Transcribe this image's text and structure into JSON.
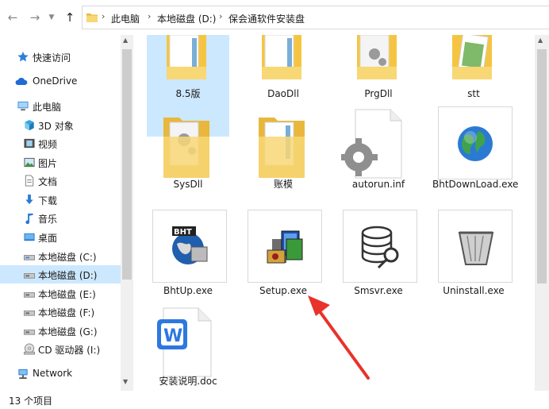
{
  "address": {
    "crumbs": [
      "此电脑",
      "本地磁盘 (D:)",
      "保会通软件安装盘"
    ],
    "back_icon": "arrow-left-icon",
    "forward_icon": "arrow-right-icon",
    "up_icon": "arrow-up-icon"
  },
  "nav": {
    "items": [
      {
        "label": "快速访问",
        "icon": "star-icon"
      },
      {
        "label": "OneDrive",
        "icon": "cloud-icon"
      },
      {
        "label": "此电脑",
        "icon": "computer-icon"
      },
      {
        "label": "3D 对象",
        "icon": "cube-icon"
      },
      {
        "label": "视频",
        "icon": "film-icon"
      },
      {
        "label": "图片",
        "icon": "picture-icon"
      },
      {
        "label": "文档",
        "icon": "document-icon"
      },
      {
        "label": "下载",
        "icon": "download-icon"
      },
      {
        "label": "音乐",
        "icon": "music-icon"
      },
      {
        "label": "桌面",
        "icon": "desktop-icon"
      },
      {
        "label": "本地磁盘 (C:)",
        "icon": "drive-icon"
      },
      {
        "label": "本地磁盘 (D:)",
        "icon": "drive-icon",
        "selected": true
      },
      {
        "label": "本地磁盘 (E:)",
        "icon": "drive-icon"
      },
      {
        "label": "本地磁盘 (F:)",
        "icon": "drive-icon"
      },
      {
        "label": "本地磁盘 (G:)",
        "icon": "drive-icon"
      },
      {
        "label": "CD 驱动器 (I:)",
        "icon": "cd-drive-icon"
      },
      {
        "label": "Network",
        "icon": "network-icon"
      }
    ]
  },
  "files": [
    {
      "name": "8.5版",
      "type": "folder",
      "selected": true
    },
    {
      "name": "DaoDll",
      "type": "folder"
    },
    {
      "name": "PrgDll",
      "type": "folder"
    },
    {
      "name": "stt",
      "type": "folder"
    },
    {
      "name": "SysDll",
      "type": "folder"
    },
    {
      "name": "账模",
      "type": "folder"
    },
    {
      "name": "autorun.inf",
      "type": "inf"
    },
    {
      "name": "BhtDownLoad.exe",
      "type": "exe"
    },
    {
      "name": "BhtUp.exe",
      "type": "exe"
    },
    {
      "name": "Setup.exe",
      "type": "exe"
    },
    {
      "name": "Smsvr.exe",
      "type": "exe"
    },
    {
      "name": "Uninstall.exe",
      "type": "exe"
    },
    {
      "name": "安装说明.doc",
      "type": "doc"
    }
  ],
  "status": {
    "count": "13 个项目"
  },
  "colors": {
    "selection": "#cce8ff",
    "folder": "#f5c542",
    "annotation_arrow": "#e8322b"
  }
}
